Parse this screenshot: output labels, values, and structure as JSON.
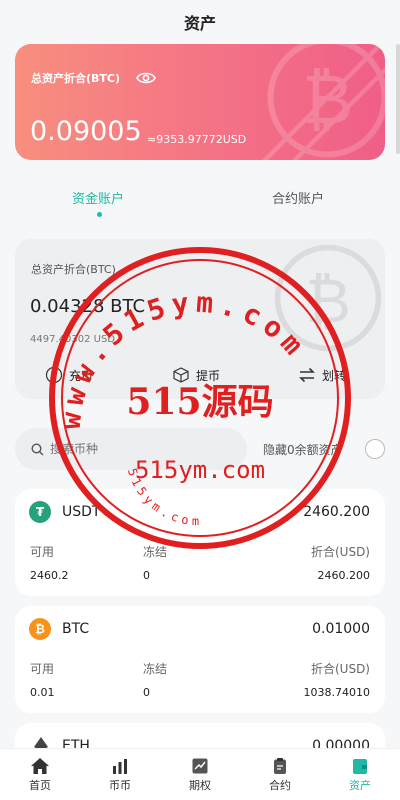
{
  "header": {
    "title": "资产"
  },
  "hero": {
    "label": "总资产折合(BTC)",
    "btc_value": "0.09005",
    "usd_value": "≈9353.97772USD"
  },
  "tabs": [
    {
      "label": "资金账户",
      "active": true
    },
    {
      "label": "合约账户",
      "active": false
    }
  ],
  "account": {
    "label": "总资产折合(BTC)",
    "btc_value": "0.04328 BTC",
    "usd_value": "4497.40302 USD",
    "actions": [
      {
        "label": "充币",
        "icon": "deposit-icon"
      },
      {
        "label": "提币",
        "icon": "withdraw-icon"
      },
      {
        "label": "划转",
        "icon": "transfer-icon"
      }
    ]
  },
  "search": {
    "placeholder": "搜索币种",
    "hide_zero_label": "隐藏0余额资产",
    "hide_zero_checked": false
  },
  "coins": [
    {
      "name": "USDT",
      "amount": "2460.200",
      "available_label": "可用",
      "frozen_label": "冻结",
      "converted_label": "折合(USD)",
      "available": "2460.2",
      "frozen": "0",
      "converted": "2460.200",
      "color": "#26a17b",
      "icon": "usdt-icon"
    },
    {
      "name": "BTC",
      "amount": "0.01000",
      "available_label": "可用",
      "frozen_label": "冻结",
      "converted_label": "折合(USD)",
      "available": "0.01",
      "frozen": "0",
      "converted": "1038.74010",
      "color": "#f7931a",
      "icon": "btc-icon"
    },
    {
      "name": "ETH",
      "amount": "0.00000",
      "icon": "eth-icon"
    }
  ],
  "watermark": {
    "top_text": "www.515ym.com",
    "center_text": "515源码",
    "bottom_url": "515ym.com",
    "small_text": "515ym.com"
  },
  "nav": [
    {
      "label": "首页",
      "icon": "home-icon",
      "active": false
    },
    {
      "label": "币币",
      "icon": "bar-chart-icon",
      "active": false
    },
    {
      "label": "期权",
      "icon": "options-icon",
      "active": false
    },
    {
      "label": "合约",
      "icon": "contract-icon",
      "active": false
    },
    {
      "label": "资产",
      "icon": "wallet-icon",
      "active": true
    }
  ],
  "colors": {
    "accent": "#1fb9a4",
    "hero_start": "#f88e7e",
    "hero_end": "#f05e87",
    "stamp": "#e02020"
  }
}
